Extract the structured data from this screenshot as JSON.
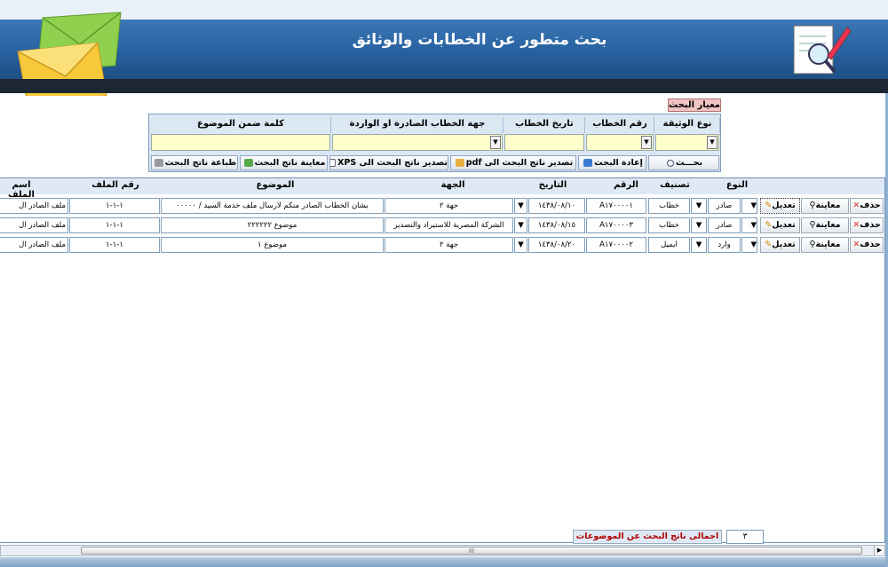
{
  "header": {
    "title": "بحث متطور عن الخطابات والوثائق"
  },
  "icons": {
    "envelope": "envelope-icon",
    "document": "document-edit-icon"
  },
  "criteria": {
    "label": "معيار البحث",
    "columns": [
      "نوع الوثيقة",
      "رقم الخطاب",
      "تاريخ الخطاب",
      "جهة الخطاب الصادرة او الواردة",
      "كلمة ضمن الموضوع"
    ],
    "buttons": {
      "search": "بحـــث",
      "reset": "إعادة البحث",
      "export_pdf": "تصدير ناتج البحث الى pdf",
      "export_xps": "تصدير ناتج البحث الى XPS",
      "preview": "معاينة ناتج البحث",
      "print": "طباعة ناتج البحث"
    }
  },
  "grid": {
    "headers": {
      "type": "النوع",
      "class": "تصنيف",
      "number": "الرقم",
      "date": "التاريخ",
      "party": "الجهة",
      "subject": "الموضوع",
      "file_no": "رقم الملف",
      "file_name": "اسم الملف"
    },
    "actions": {
      "delete": "حذف",
      "view": "معاينة",
      "edit": "تعديل"
    },
    "rows": [
      {
        "type": "صادر",
        "class": "خطاب",
        "number": "A١٧٠٠٠٠١",
        "date": "١٤٣٨/٠٨/١٠",
        "party": "جهة ٢",
        "subject": "بشان الخطاب الصادر منكم لارسال ملف خدمة السيد / ٠٠٠٠٠",
        "file_no": "١-١-١",
        "file_name": "ملف الصادر ال"
      },
      {
        "type": "صادر",
        "class": "خطاب",
        "number": "A١٧٠٠٠٠٣",
        "date": "١٤٣٨/٠٨/١٥",
        "party": "الشركة المصرية للاستيراد والتصدير",
        "subject": "موضوع ٢٢٢٢٢٢",
        "file_no": "١-١-١",
        "file_name": "ملف الصادر ال"
      },
      {
        "type": "وارد",
        "class": "ايميل",
        "number": "A١٧٠٠٠٠٢",
        "date": "١٤٣٨/٠٨/٢٠",
        "party": "جهة ٢",
        "subject": "موضوع ١",
        "file_no": "١-١-١",
        "file_name": "ملف الصادر ال"
      }
    ]
  },
  "footer": {
    "total_label": "اجمالى ناتج البحث عن الموضوعات",
    "total_value": "٣",
    "scroll_mark": "III"
  },
  "colors": {
    "header_blue": "#27609f",
    "field_yellow": "#ffffcc",
    "label_pink": "#f2c4c4",
    "total_red": "#b00000"
  }
}
